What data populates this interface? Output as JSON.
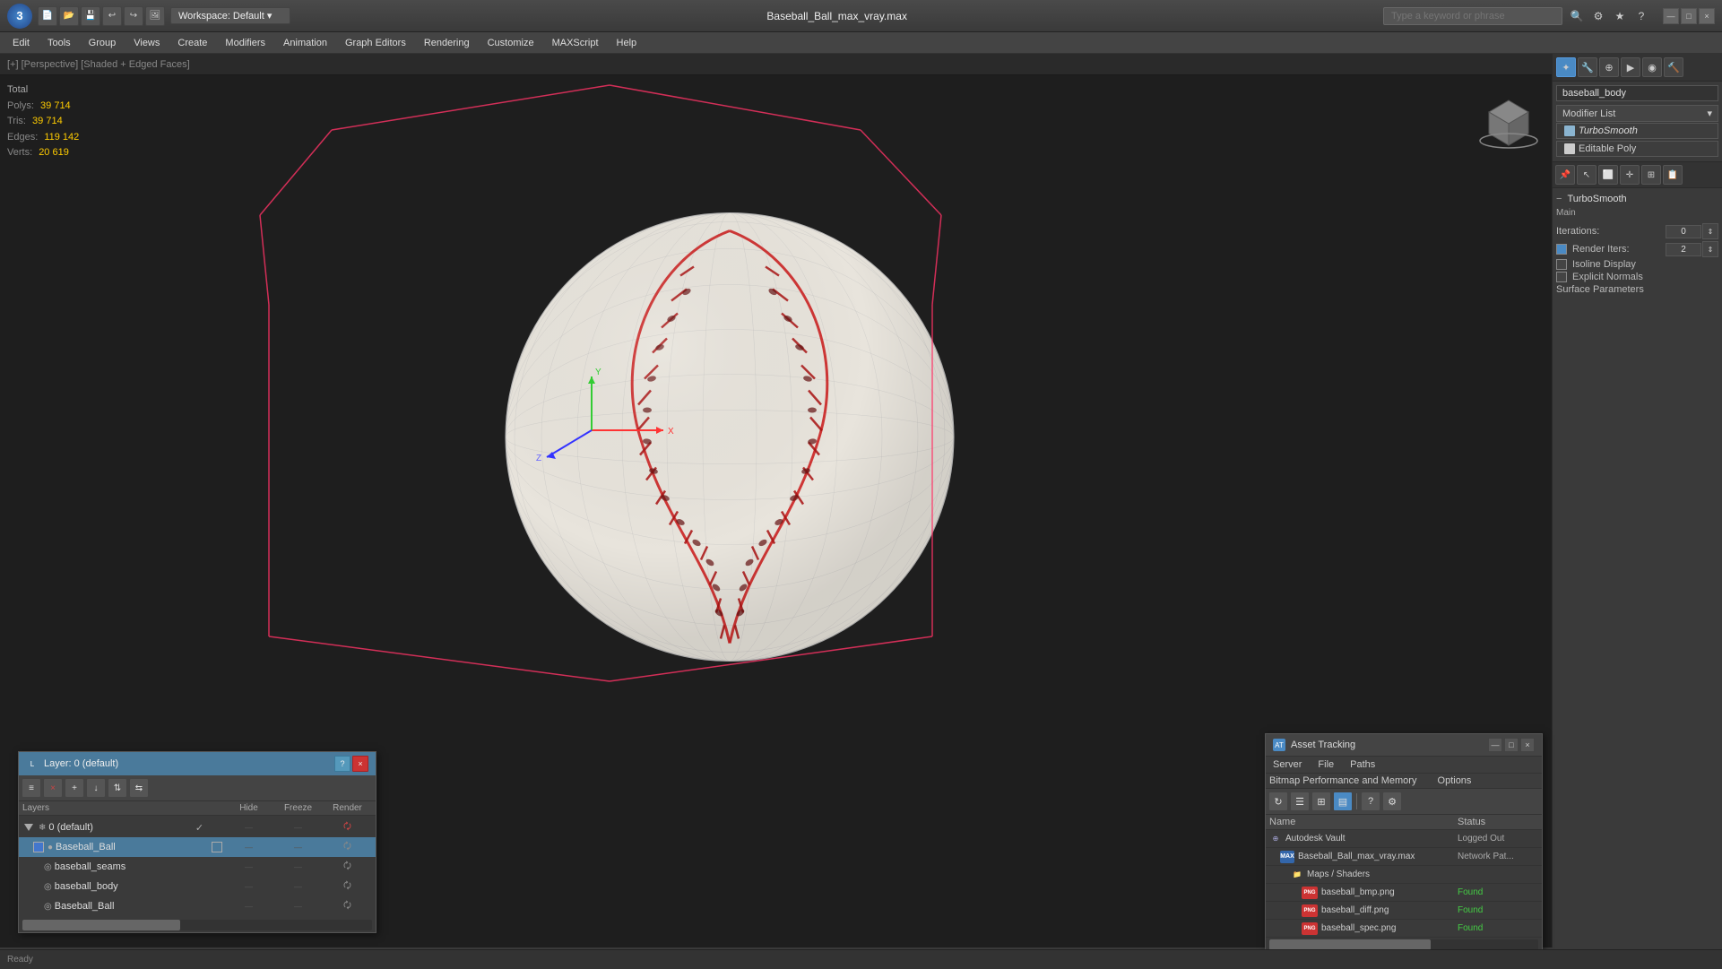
{
  "app": {
    "title": "Baseball_Ball_max_vray.max",
    "workspace": "Workspace: Default",
    "logo": "3"
  },
  "titlebar": {
    "search_placeholder": "Type a keyword or phrase",
    "window_title": "Baseball_Ball_max_vray.max"
  },
  "menubar": {
    "items": [
      "Edit",
      "Tools",
      "Group",
      "Views",
      "Create",
      "Modifiers",
      "Animation",
      "Graph Editors",
      "Rendering",
      "Customize",
      "MAXScript",
      "Help"
    ]
  },
  "viewport": {
    "label": "[+] [Perspective] [Shaded + Edged Faces]",
    "stats": {
      "total_label": "Total",
      "polys_label": "Polys:",
      "polys_value": "39 714",
      "tris_label": "Tris:",
      "tris_value": "39 714",
      "edges_label": "Edges:",
      "edges_value": "119 142",
      "verts_label": "Verts:",
      "verts_value": "20 619"
    }
  },
  "right_panel": {
    "object_name": "baseball_body",
    "modifier_list_label": "Modifier List",
    "modifiers": [
      {
        "name": "TurboSmooth",
        "italic": true,
        "icon": "light-blue"
      },
      {
        "name": "Editable Poly",
        "italic": false,
        "icon": "white"
      }
    ],
    "turbosmooth": {
      "header": "TurboSmooth",
      "main_label": "Main",
      "iterations_label": "Iterations:",
      "iterations_value": "0",
      "render_iters_label": "Render Iters:",
      "render_iters_value": "2",
      "render_iters_checked": true,
      "isoline_label": "Isoline Display",
      "explicit_normals_label": "Explicit Normals",
      "surface_params_label": "Surface Parameters"
    }
  },
  "layers_panel": {
    "title": "Layer: 0 (default)",
    "help": "?",
    "close": "×",
    "toolbar_buttons": [
      "≡",
      "×",
      "+",
      "↓",
      "⇅",
      "⇆"
    ],
    "columns": {
      "name": "Layers",
      "hide": "Hide",
      "freeze": "Freeze",
      "render": "Render"
    },
    "rows": [
      {
        "indent": 0,
        "icon": "❄",
        "name": "0 (default)",
        "checked": true,
        "type": "layer"
      },
      {
        "indent": 1,
        "icon": "●",
        "name": "Baseball_Ball",
        "selected": true,
        "type": "object",
        "color": "blue"
      },
      {
        "indent": 2,
        "icon": "◎",
        "name": "baseball_seams",
        "type": "object"
      },
      {
        "indent": 2,
        "icon": "◎",
        "name": "baseball_body",
        "type": "object"
      },
      {
        "indent": 2,
        "icon": "◎",
        "name": "Baseball_Ball",
        "type": "object"
      }
    ]
  },
  "asset_tracking": {
    "title": "Asset Tracking",
    "menus": [
      "Server",
      "File",
      "Paths"
    ],
    "submenu": "Bitmap Performance and Memory",
    "submenu2": "Options",
    "toolbar_icons": [
      "📁",
      "📋",
      "📊",
      "🗂"
    ],
    "columns": {
      "name": "Name",
      "status": "Status"
    },
    "rows": [
      {
        "indent": 0,
        "icon": "vault",
        "name": "Autodesk Vault",
        "status": "Logged Out"
      },
      {
        "indent": 1,
        "icon": "max",
        "name": "Baseball_Ball_max_vray.max",
        "status": "Network Pat..."
      },
      {
        "indent": 2,
        "icon": "folder",
        "name": "Maps / Shaders",
        "status": ""
      },
      {
        "indent": 3,
        "icon": "png",
        "name": "baseball_bmp.png",
        "status": "Found"
      },
      {
        "indent": 3,
        "icon": "png",
        "name": "baseball_diff.png",
        "status": "Found"
      },
      {
        "indent": 3,
        "icon": "png",
        "name": "baseball_spec.png",
        "status": "Found"
      }
    ]
  }
}
